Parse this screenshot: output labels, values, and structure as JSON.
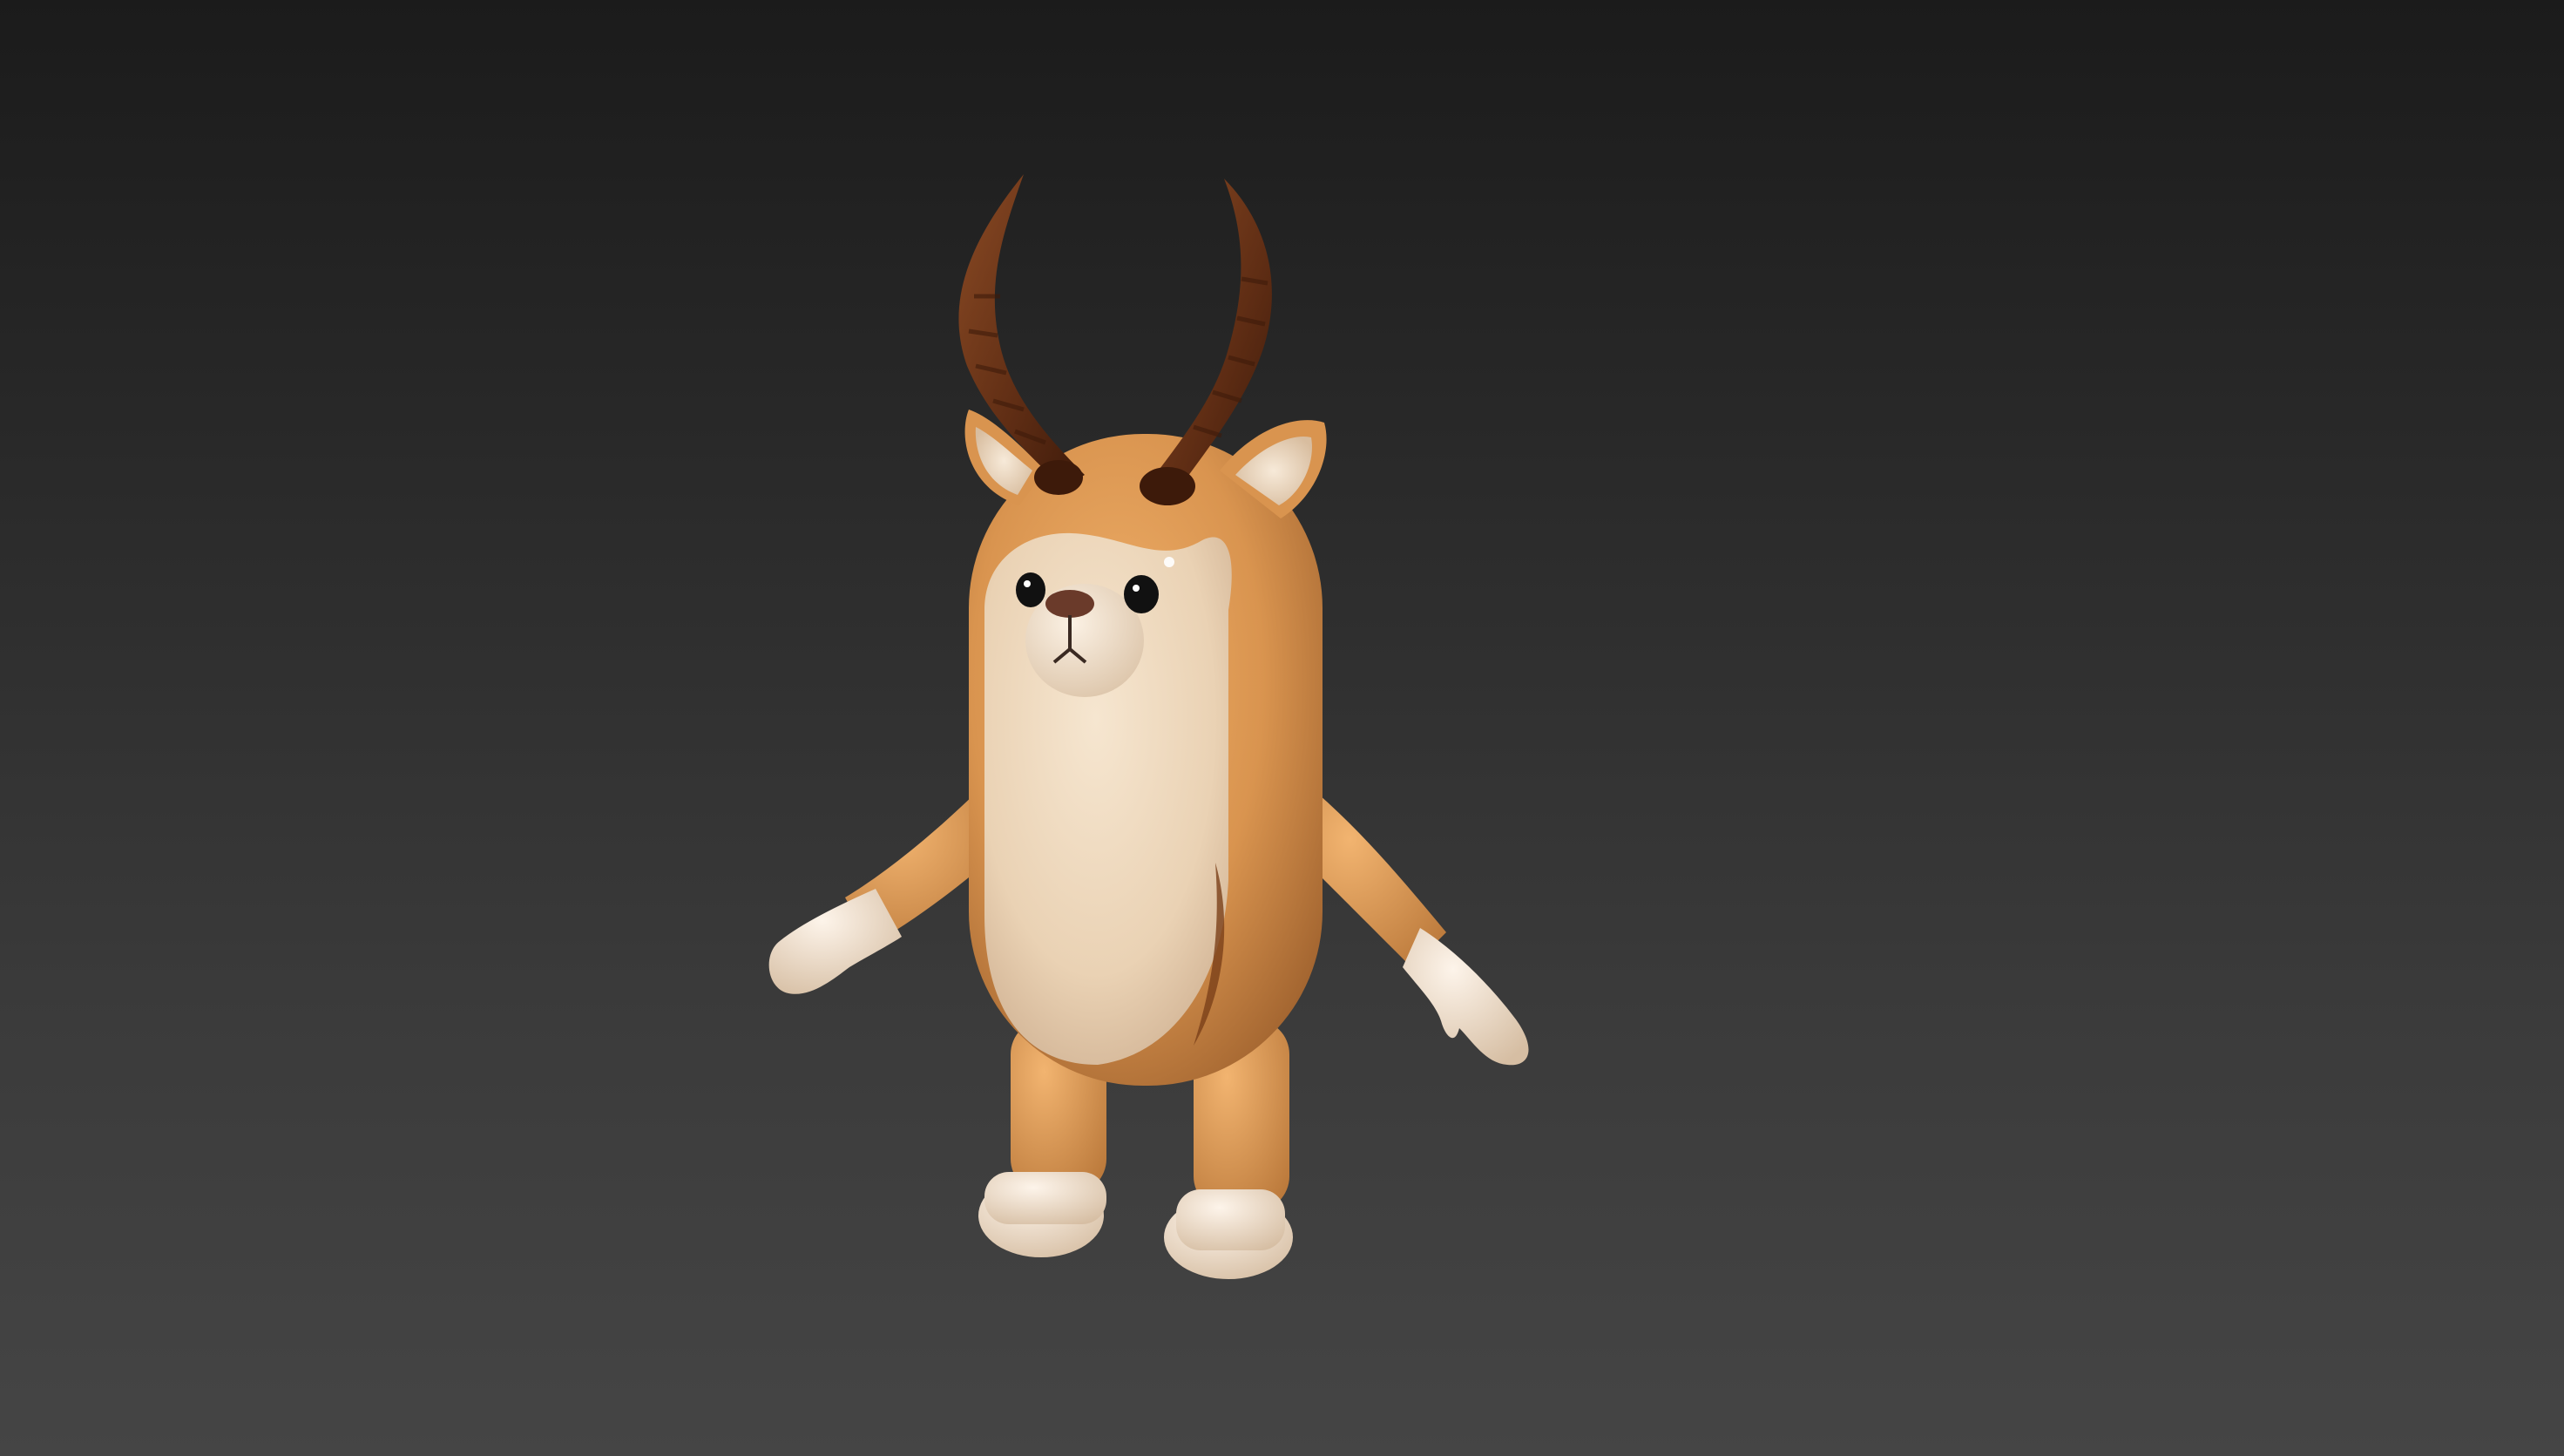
{
  "viewport": {
    "background_top": "#1b1b1b",
    "background_bottom": "#454545"
  },
  "subject": {
    "kind": "cartoon-antelope-3d-model",
    "colors": {
      "fur": "#d9944f",
      "fur_shadow": "#b8743a",
      "belly": "#ead2b4",
      "muzzle": "#f1e2cf",
      "horn": "#6b3418",
      "horn_dark": "#3d1a0a",
      "eye": "#111111",
      "nose": "#6a3a2a",
      "hoof": "#f3e4d2"
    }
  }
}
